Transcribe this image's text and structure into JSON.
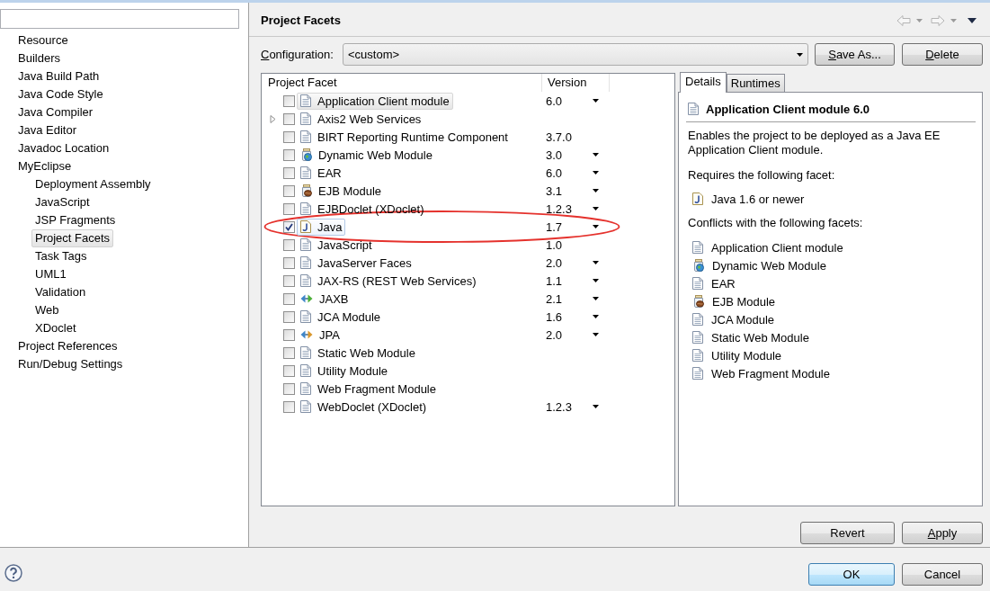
{
  "sidebar": {
    "items": [
      {
        "label": "Resource",
        "selected": false
      },
      {
        "label": "Builders",
        "selected": false
      },
      {
        "label": "Java Build Path",
        "selected": false
      },
      {
        "label": "Java Code Style",
        "selected": false
      },
      {
        "label": "Java Compiler",
        "selected": false
      },
      {
        "label": "Java Editor",
        "selected": false
      },
      {
        "label": "Javadoc Location",
        "selected": false
      },
      {
        "label": "MyEclipse",
        "selected": false,
        "children": [
          {
            "label": "Deployment Assembly",
            "selected": false
          },
          {
            "label": "JavaScript",
            "selected": false
          },
          {
            "label": "JSP Fragments",
            "selected": false
          },
          {
            "label": "Project Facets",
            "selected": true
          },
          {
            "label": "Task Tags",
            "selected": false
          },
          {
            "label": "UML1",
            "selected": false
          },
          {
            "label": "Validation",
            "selected": false
          },
          {
            "label": "Web",
            "selected": false
          },
          {
            "label": "XDoclet",
            "selected": false
          }
        ]
      },
      {
        "label": "Project References",
        "selected": false
      },
      {
        "label": "Run/Debug Settings",
        "selected": false
      }
    ]
  },
  "page": {
    "title": "Project Facets",
    "history": [
      {
        "kind": "back",
        "disabled": true
      },
      {
        "kind": "forward",
        "disabled": true
      }
    ]
  },
  "configuration": {
    "label": "Configuration:",
    "mnemonic": true,
    "value": "<custom>",
    "buttons": [
      {
        "label": "Save As...",
        "mnemonic": true
      },
      {
        "label": "Delete",
        "mnemonic": true
      }
    ]
  },
  "facets_table": {
    "columns": [
      "Project Facet",
      "Version"
    ],
    "rows": [
      {
        "name": "Application Client module",
        "kind": "document",
        "version": "6.0",
        "version_menu": true,
        "checked": false,
        "expandable": false,
        "selected": true,
        "hovered": false,
        "circled": false
      },
      {
        "name": "Axis2 Web Services",
        "kind": "document",
        "version_menu": false,
        "checked": false,
        "expandable": true,
        "selected": false,
        "hovered": false,
        "circled": false
      },
      {
        "name": "BIRT Reporting Runtime Component",
        "kind": "document",
        "version": "3.7.0",
        "version_menu": false,
        "checked": false,
        "expandable": false,
        "selected": false,
        "hovered": false,
        "circled": false
      },
      {
        "name": "Dynamic Web Module",
        "kind": "globe",
        "version": "3.0",
        "version_menu": true,
        "checked": false,
        "expandable": false,
        "selected": false,
        "hovered": false,
        "circled": false
      },
      {
        "name": "EAR",
        "kind": "document",
        "version": "6.0",
        "version_menu": true,
        "checked": false,
        "expandable": false,
        "selected": false,
        "hovered": false,
        "circled": false
      },
      {
        "name": "EJB Module",
        "kind": "bean",
        "version": "3.1",
        "version_menu": true,
        "checked": false,
        "expandable": false,
        "selected": false,
        "hovered": false,
        "circled": false
      },
      {
        "name": "EJBDoclet (XDoclet)",
        "kind": "document",
        "version": "1.2.3",
        "version_menu": true,
        "checked": false,
        "expandable": false,
        "selected": false,
        "hovered": false,
        "circled": false
      },
      {
        "name": "Java",
        "kind": "java",
        "version": "1.7",
        "version_menu": true,
        "checked": true,
        "expandable": false,
        "selected": false,
        "hovered": true,
        "circled": true
      },
      {
        "name": "JavaScript",
        "kind": "document",
        "version": "1.0",
        "version_menu": false,
        "checked": false,
        "expandable": false,
        "selected": false,
        "hovered": false,
        "circled": false
      },
      {
        "name": "JavaServer Faces",
        "kind": "document",
        "version": "2.0",
        "version_menu": true,
        "checked": false,
        "expandable": false,
        "selected": false,
        "hovered": false,
        "circled": false
      },
      {
        "name": "JAX-RS (REST Web Services)",
        "kind": "document",
        "version": "1.1",
        "version_menu": true,
        "checked": false,
        "expandable": false,
        "selected": false,
        "hovered": false,
        "circled": false
      },
      {
        "name": "JAXB",
        "kind": "binding",
        "version": "2.1",
        "version_menu": true,
        "checked": false,
        "expandable": false,
        "selected": false,
        "hovered": false,
        "circled": false
      },
      {
        "name": "JCA Module",
        "kind": "document",
        "version": "1.6",
        "version_menu": true,
        "checked": false,
        "expandable": false,
        "selected": false,
        "hovered": false,
        "circled": false
      },
      {
        "name": "JPA",
        "kind": "persistence",
        "version": "2.0",
        "version_menu": true,
        "checked": false,
        "expandable": false,
        "selected": false,
        "hovered": false,
        "circled": false
      },
      {
        "name": "Static Web Module",
        "kind": "document",
        "version_menu": false,
        "checked": false,
        "expandable": false,
        "selected": false,
        "hovered": false,
        "circled": false
      },
      {
        "name": "Utility Module",
        "kind": "document",
        "version_menu": false,
        "checked": false,
        "expandable": false,
        "selected": false,
        "hovered": false,
        "circled": false
      },
      {
        "name": "Web Fragment Module",
        "kind": "document",
        "version_menu": false,
        "checked": false,
        "expandable": false,
        "selected": false,
        "hovered": false,
        "circled": false
      },
      {
        "name": "WebDoclet (XDoclet)",
        "kind": "document",
        "version": "1.2.3",
        "version_menu": true,
        "checked": false,
        "expandable": false,
        "selected": false,
        "hovered": false,
        "circled": false
      }
    ]
  },
  "details": {
    "tabs": [
      {
        "label": "Details",
        "selected": true
      },
      {
        "label": "Runtimes",
        "selected": false
      }
    ],
    "heading": {
      "label": "Application Client module 6.0",
      "kind": "document"
    },
    "description": "Enables the project to be deployed as a Java EE Application Client module.",
    "requires_heading": "Requires the following facet:",
    "requires": [
      {
        "label": "Java 1.6 or newer",
        "kind": "java"
      }
    ],
    "conflicts_heading": "Conflicts with the following facets:",
    "conflicts": [
      {
        "label": "Application Client module",
        "kind": "document"
      },
      {
        "label": "Dynamic Web Module",
        "kind": "globe"
      },
      {
        "label": "EAR",
        "kind": "document"
      },
      {
        "label": "EJB Module",
        "kind": "bean"
      },
      {
        "label": "JCA Module",
        "kind": "document"
      },
      {
        "label": "Static Web Module",
        "kind": "document"
      },
      {
        "label": "Utility Module",
        "kind": "document"
      },
      {
        "label": "Web Fragment Module",
        "kind": "document"
      }
    ]
  },
  "page_buttons": [
    {
      "label": "Revert",
      "mnemonic": false
    },
    {
      "label": "Apply",
      "mnemonic": true
    }
  ],
  "dialog_buttons": [
    {
      "label": "OK",
      "default": true
    },
    {
      "label": "Cancel",
      "default": false
    }
  ]
}
